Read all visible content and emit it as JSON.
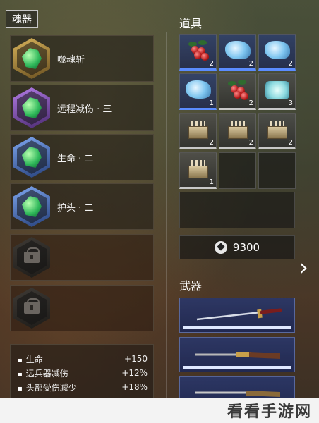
{
  "soul_panel": {
    "title": "魂器",
    "slots": [
      {
        "label": "噬魂斩",
        "rarity": "gold",
        "state": "equipped"
      },
      {
        "label": "远程减伤 · 三",
        "rarity": "purple",
        "state": "equipped"
      },
      {
        "label": "生命 · 二",
        "rarity": "blue",
        "state": "equipped"
      },
      {
        "label": "护头 · 二",
        "rarity": "blue",
        "state": "equipped"
      },
      {
        "label": "",
        "rarity": "locked",
        "state": "locked"
      },
      {
        "label": "",
        "rarity": "locked",
        "state": "locked"
      }
    ],
    "stats": [
      {
        "name": "生命",
        "value": "+150"
      },
      {
        "name": "远兵器减伤",
        "value": "+12%"
      },
      {
        "name": "头部受伤减少",
        "value": "+18%"
      }
    ]
  },
  "items_panel": {
    "title": "道具",
    "items": [
      {
        "icon": "berries-icon",
        "count": "2",
        "rarity": "rare"
      },
      {
        "icon": "cloth-icon",
        "count": "2",
        "rarity": "rare"
      },
      {
        "icon": "cloth-icon",
        "count": "2",
        "rarity": "rare"
      },
      {
        "icon": "cloth-icon",
        "count": "1",
        "rarity": "rare"
      },
      {
        "icon": "berries-icon",
        "count": "2",
        "rarity": "normal"
      },
      {
        "icon": "ice-icon",
        "count": "3",
        "rarity": "normal"
      },
      {
        "icon": "crate-icon",
        "count": "2",
        "rarity": "normal"
      },
      {
        "icon": "crate-icon",
        "count": "2",
        "rarity": "normal"
      },
      {
        "icon": "crate-icon",
        "count": "2",
        "rarity": "normal"
      },
      {
        "icon": "crate-icon",
        "count": "1",
        "rarity": "normal"
      }
    ],
    "currency": {
      "icon": "coin-icon",
      "amount": "9300"
    }
  },
  "weapons_panel": {
    "title": "武器",
    "weapons": [
      {
        "icon": "katana-icon"
      },
      {
        "icon": "rifle-icon"
      },
      {
        "icon": "musket-icon"
      }
    ]
  },
  "navigation": {
    "next_icon": "chevron-right-icon",
    "next_glyph": "›"
  },
  "watermark": {
    "text": "看看手游网"
  },
  "colors": {
    "rare": "#5b8cff",
    "normal": "#c8c8c8",
    "gold": "#d6b25a",
    "purple": "#b37ce6",
    "blue": "#7ea6f0"
  }
}
